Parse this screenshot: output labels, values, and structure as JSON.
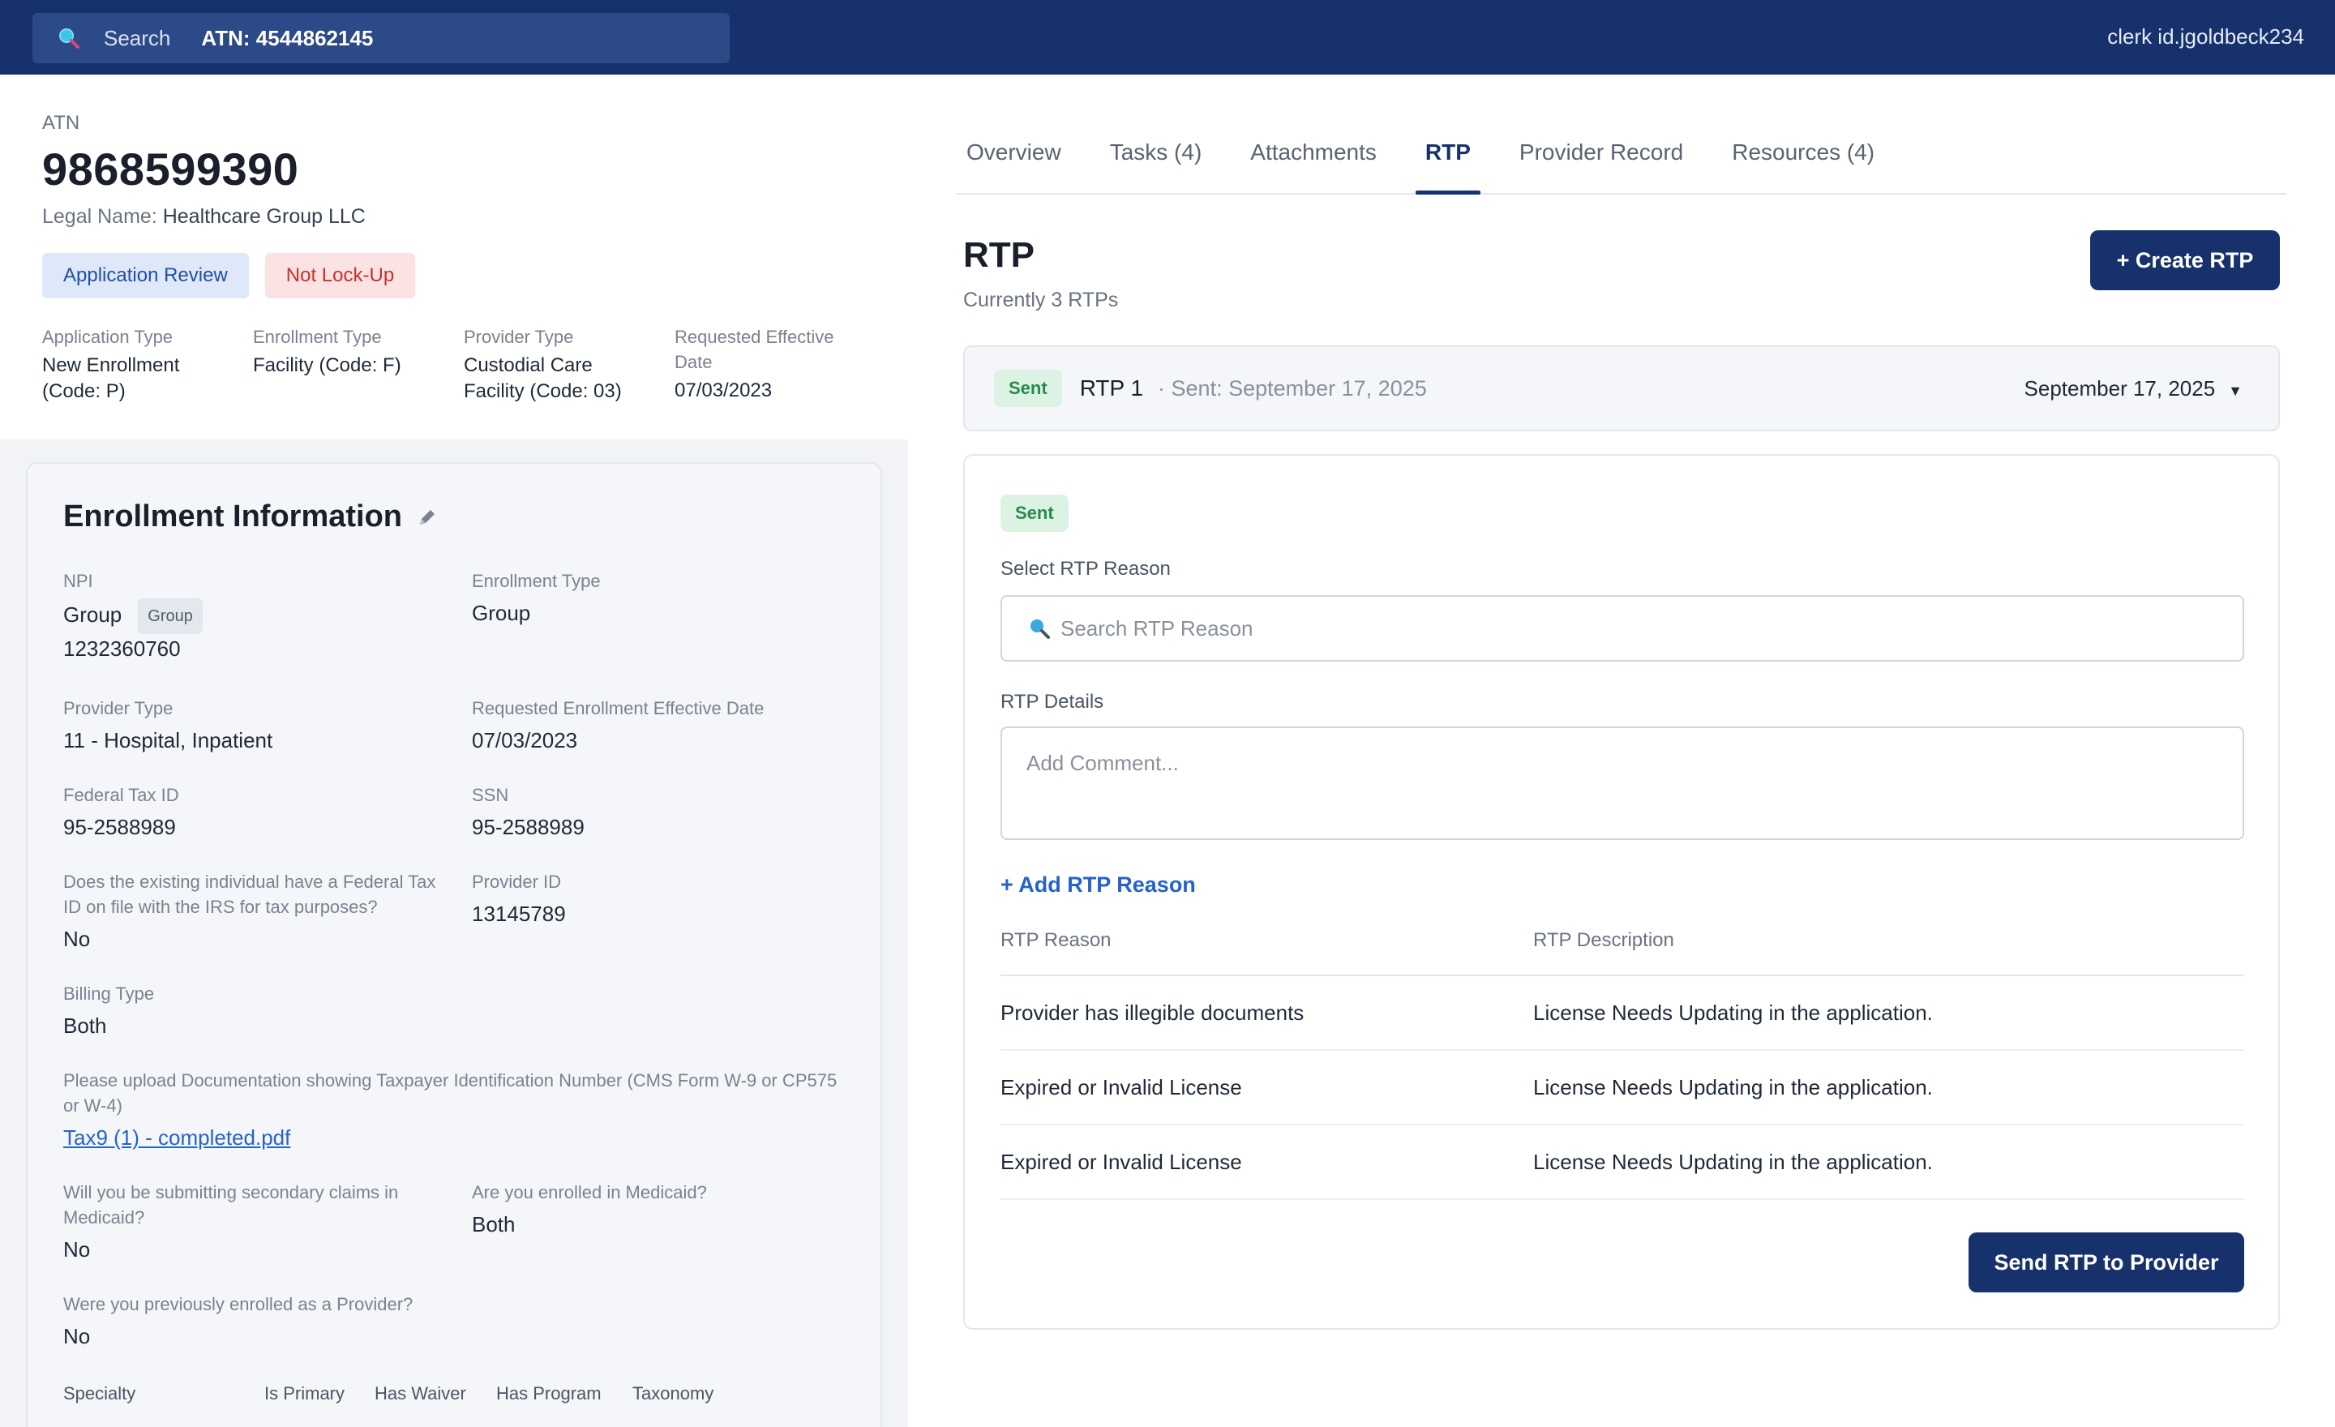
{
  "topbar": {
    "search_label": "Search",
    "search_value": "ATN: 4544862145",
    "user": "clerk id.jgoldbeck234",
    "icons": [
      "search-icon"
    ]
  },
  "header": {
    "atn_label": "ATN",
    "atn_number": "9868599390",
    "legal_label": "Legal Name:",
    "legal_name": "Healthcare Group LLC",
    "badges": [
      {
        "label": "Application Review",
        "color": "#1f4fa6"
      },
      {
        "label": "Not Lock-Up",
        "color": "#c9302c"
      }
    ],
    "meta": [
      {
        "key": "Application Type",
        "value": "New Enrollment (Code: P)"
      },
      {
        "key": "Enrollment Type",
        "value": "Facility (Code: F)"
      },
      {
        "key": "Provider Type",
        "value": "Custodial Care Facility (Code: 03)"
      },
      {
        "key": "Requested Effective Date",
        "value": "07/03/2023"
      }
    ]
  },
  "enrollment": {
    "title": "Enrollment Information",
    "npi_label": "NPI",
    "npi_type": "Group",
    "npi_chip": "Group",
    "npi_number": "1232360760",
    "enrollment_type_label": "Enrollment Type",
    "enrollment_type": "Group",
    "provider_type_label": "Provider Type",
    "provider_type": "11 - Hospital, Inpatient",
    "req_date_label": "Requested Enrollment Effective Date",
    "req_date": "07/03/2023",
    "tax_label": "Federal Tax ID",
    "tax_id": "95-2588989",
    "ssn_label": "SSN",
    "ssn": "95-2588989",
    "irs_question": "Does the existing individual have a Federal Tax ID on file with the IRS for tax purposes?",
    "irs_answer": "No",
    "provider_id_label": "Provider ID",
    "provider_id": "13145789",
    "billing_label": "Billing Type",
    "billing": "Both",
    "upload_label": "Please upload Documentation showing Taxpayer Identification Number (CMS Form W-9 or CP575 or W-4)",
    "upload_file": "Tax9 (1) - completed.pdf",
    "secondary_question": "Will you be submitting secondary claims in Medicaid?",
    "secondary_answer": "No",
    "medicaid_question": "Are you enrolled in Medicaid?",
    "medicaid_answer": "Both",
    "previous_question": "Were you previously enrolled as a Provider?",
    "previous_answer": "No",
    "specialty_headers": [
      "Specialty",
      "Is Primary",
      "Has Waiver",
      "Has Program",
      "Taxonomy"
    ]
  },
  "tabs": [
    {
      "label": "Overview",
      "active": false
    },
    {
      "label": "Tasks (4)",
      "active": false
    },
    {
      "label": "Attachments",
      "active": false
    },
    {
      "label": "RTP",
      "active": true
    },
    {
      "label": "Provider Record",
      "active": false
    },
    {
      "label": "Resources (4)",
      "active": false
    }
  ],
  "rtp": {
    "title": "RTP",
    "subtitle": "Currently 3 RTPs",
    "create_button": "+ Create RTP",
    "row_status": "Sent",
    "row_name": "RTP 1",
    "row_sent": "· Sent: September 17, 2025",
    "row_date": "September 17, 2025",
    "detail_status": "Sent",
    "reason_label": "Select RTP Reason",
    "reason_placeholder": "Search RTP Reason",
    "details_label": "RTP Details",
    "details_placeholder": "Add Comment...",
    "add_reason": "+ Add RTP Reason",
    "table_headers": [
      "RTP Reason",
      "RTP Description"
    ],
    "table_rows": [
      {
        "reason": "Provider has illegible documents",
        "description": "License Needs Updating in the application."
      },
      {
        "reason": "Expired or Invalid License",
        "description": "License Needs Updating in the application."
      },
      {
        "reason": "Expired or Invalid License",
        "description": "License Needs Updating in the application."
      }
    ],
    "send_button": "Send RTP to Provider"
  },
  "colors": {
    "navy": "#16316b",
    "link": "#2563c9",
    "sent_green": "#2b8a4c"
  }
}
